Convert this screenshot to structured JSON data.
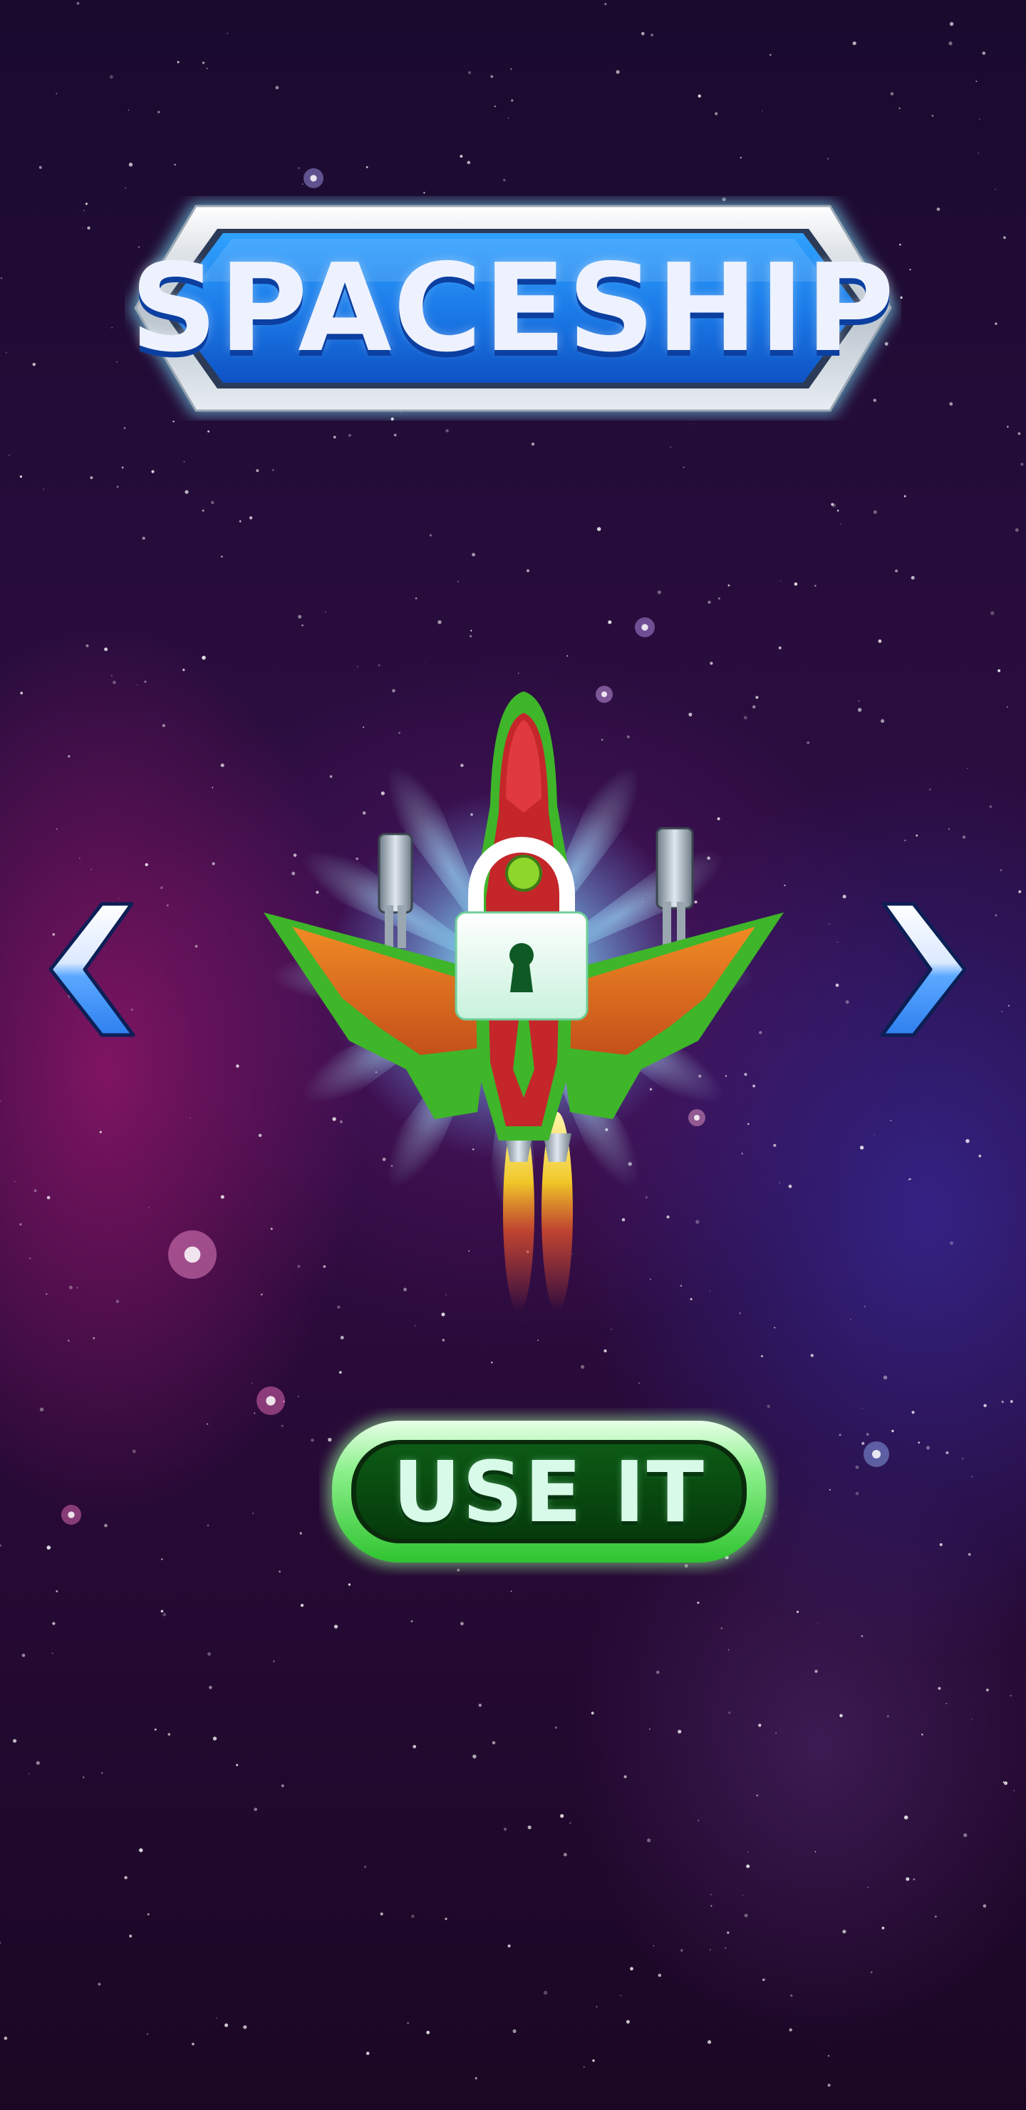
{
  "screen": {
    "title": "SPACESHIP",
    "action_button_label": "USE IT"
  },
  "ship": {
    "locked": true,
    "icon": "spaceship-icon",
    "lock_icon": "lock-icon"
  },
  "navigation": {
    "prev_icon": "chevron-left-icon",
    "next_icon": "chevron-right-icon"
  },
  "colors": {
    "title_fill": "#1a78e6",
    "title_frame": "#c9d2dc",
    "button_fill": "#0a4a12",
    "button_rim": "#4ee24e",
    "arrow": "#6fb6ff",
    "ship_body": "#c4262a",
    "ship_trim": "#3fb52a",
    "ship_wing": "#e0701a"
  }
}
